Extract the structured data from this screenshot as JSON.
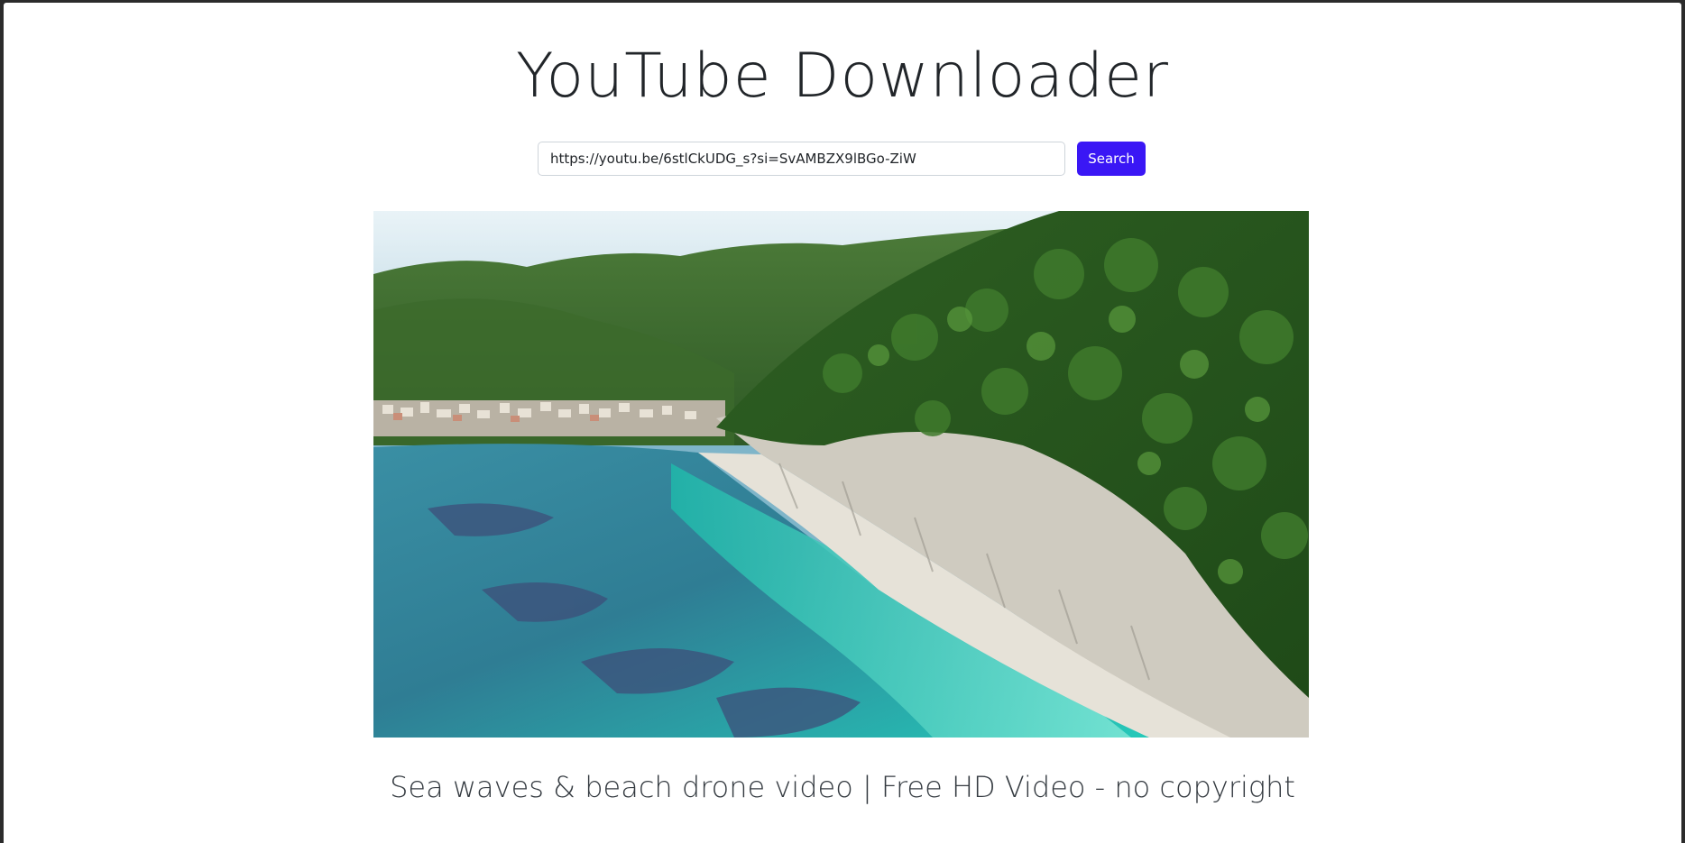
{
  "header": {
    "title": "YouTube Downloader"
  },
  "search": {
    "value": "https://youtu.be/6stlCkUDG_s?si=SvAMBZX9lBGo-ZiW",
    "button_label": "Search"
  },
  "video": {
    "title": "Sea waves & beach drone video | Free HD Video - no copyright"
  },
  "colors": {
    "accent": "#3a17f5",
    "background": "#ffffff",
    "frame": "#2b2b2b"
  }
}
